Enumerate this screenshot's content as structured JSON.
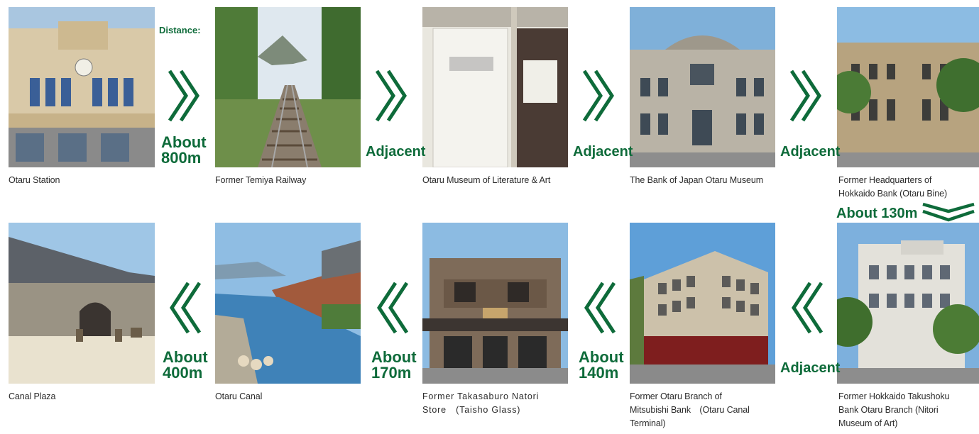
{
  "colors": {
    "accent": "#0e6b3a"
  },
  "top_row": [
    {
      "caption": "Otaru Station"
    },
    {
      "caption": "Former Temiya Railway"
    },
    {
      "caption": "Otaru Museum of Literature & Art"
    },
    {
      "caption": "The Bank of Japan Otaru Museum"
    },
    {
      "caption_l1": "Former Headquarters of",
      "caption_l2": "Hokkaido Bank (Otaru Bine)"
    }
  ],
  "bottom_row": [
    {
      "caption": "Canal Plaza"
    },
    {
      "caption": "Otaru Canal"
    },
    {
      "caption_l1": "Former Takasaburo Natori",
      "caption_l2": "Store　(Taisho Glass)"
    },
    {
      "caption_l1": "Former Otaru Branch of",
      "caption_l2": "Mitsubishi Bank　(Otaru Canal",
      "caption_l3": "Terminal)"
    },
    {
      "caption_l1": "Former Hokkaido Takushoku",
      "caption_l2": "Bank Otaru Branch (Nitori",
      "caption_l3": "Museum of Art)"
    }
  ],
  "distances": {
    "label": "Distance:",
    "d1_l1": "About",
    "d1_l2": "800m",
    "d2": "Adjacent",
    "d3": "Adjacent",
    "d4": "Adjacent",
    "d5": "About 130m",
    "d6": "Adjacent",
    "d7_l1": "About",
    "d7_l2": "140m",
    "d8_l1": "About",
    "d8_l2": "170m",
    "d9_l1": "About",
    "d9_l2": "400m"
  }
}
